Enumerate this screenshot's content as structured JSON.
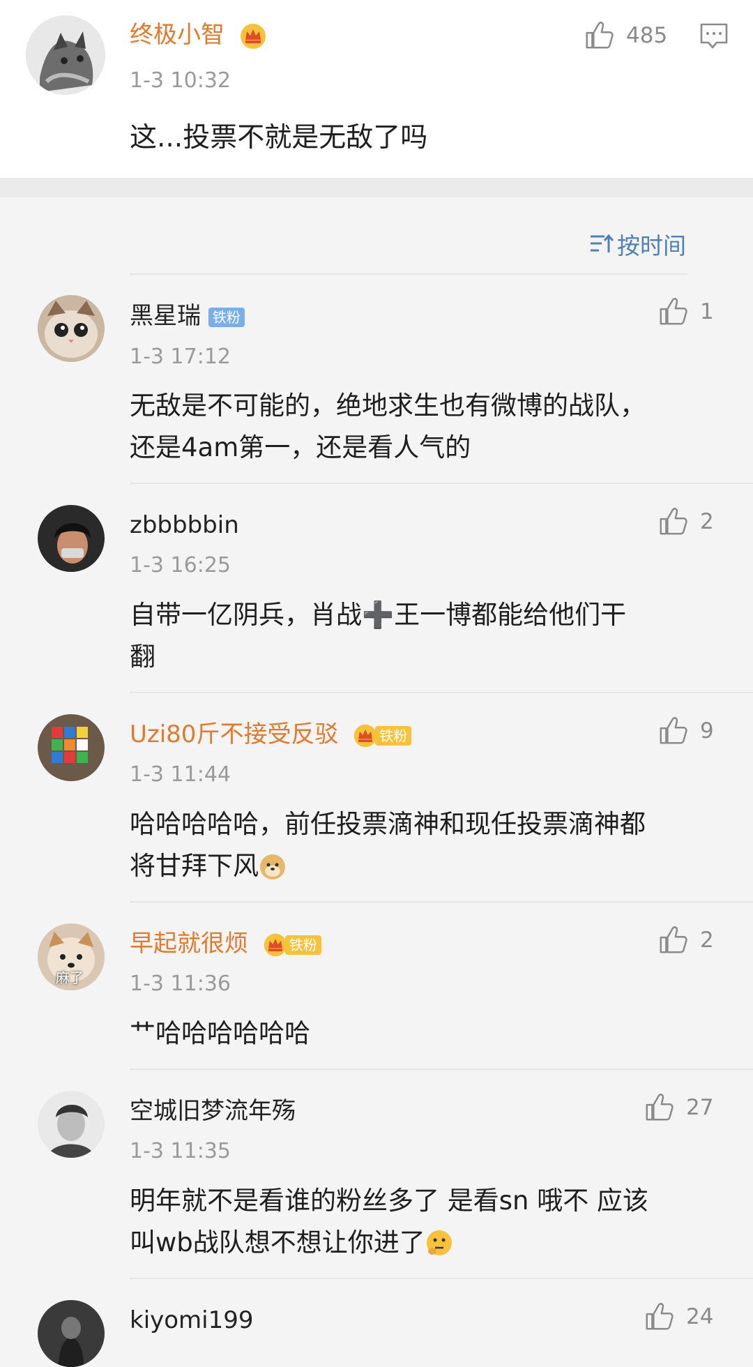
{
  "colors": {
    "vip_name": "#e3792c",
    "normal_name": "#222222",
    "sort_blue": "#4f7fb3"
  },
  "main_comment": {
    "username": "终极小智",
    "time": "1-3 10:32",
    "text": "这...投票不就是无敌了吗",
    "likes": "485",
    "badge": "crown-icon"
  },
  "sort": {
    "label": "按时间",
    "icon": "sort-icon"
  },
  "replies": [
    {
      "username": "黑星瑞",
      "badge_text": "铁粉",
      "time": "1-3 17:12",
      "likes": "1",
      "lines": [
        "无敌是不可能的，绝地求生也有微博的战队，",
        "还是4am第一，还是看人气的"
      ]
    },
    {
      "username": "zbbbbbin",
      "time": "1-3 16:25",
      "likes": "2",
      "lines": [
        "自带一亿阴兵，肖战➕王一博都能给他们干",
        "翻"
      ]
    },
    {
      "username": "Uzi80斤不接受反驳",
      "badge_text": "铁粉",
      "time": "1-3 11:44",
      "likes": "9",
      "lines": [
        "哈哈哈哈哈，前任投票滴神和现任投票滴神都",
        "将甘拜下风"
      ]
    },
    {
      "username": "早起就很烦",
      "badge_text": "铁粉",
      "time": "1-3 11:36",
      "likes": "2",
      "lines": [
        "艹哈哈哈哈哈哈"
      ],
      "avatar_text": "麻了"
    },
    {
      "username": "空城旧梦流年殇",
      "time": "1-3 11:35",
      "likes": "27",
      "lines": [
        "明年就不是看谁的粉丝多了 是看sn 哦不 应该",
        "叫wb战队想不想让你进了"
      ]
    },
    {
      "username": "kiyomi199",
      "time": "",
      "likes": "24",
      "lines": []
    }
  ]
}
